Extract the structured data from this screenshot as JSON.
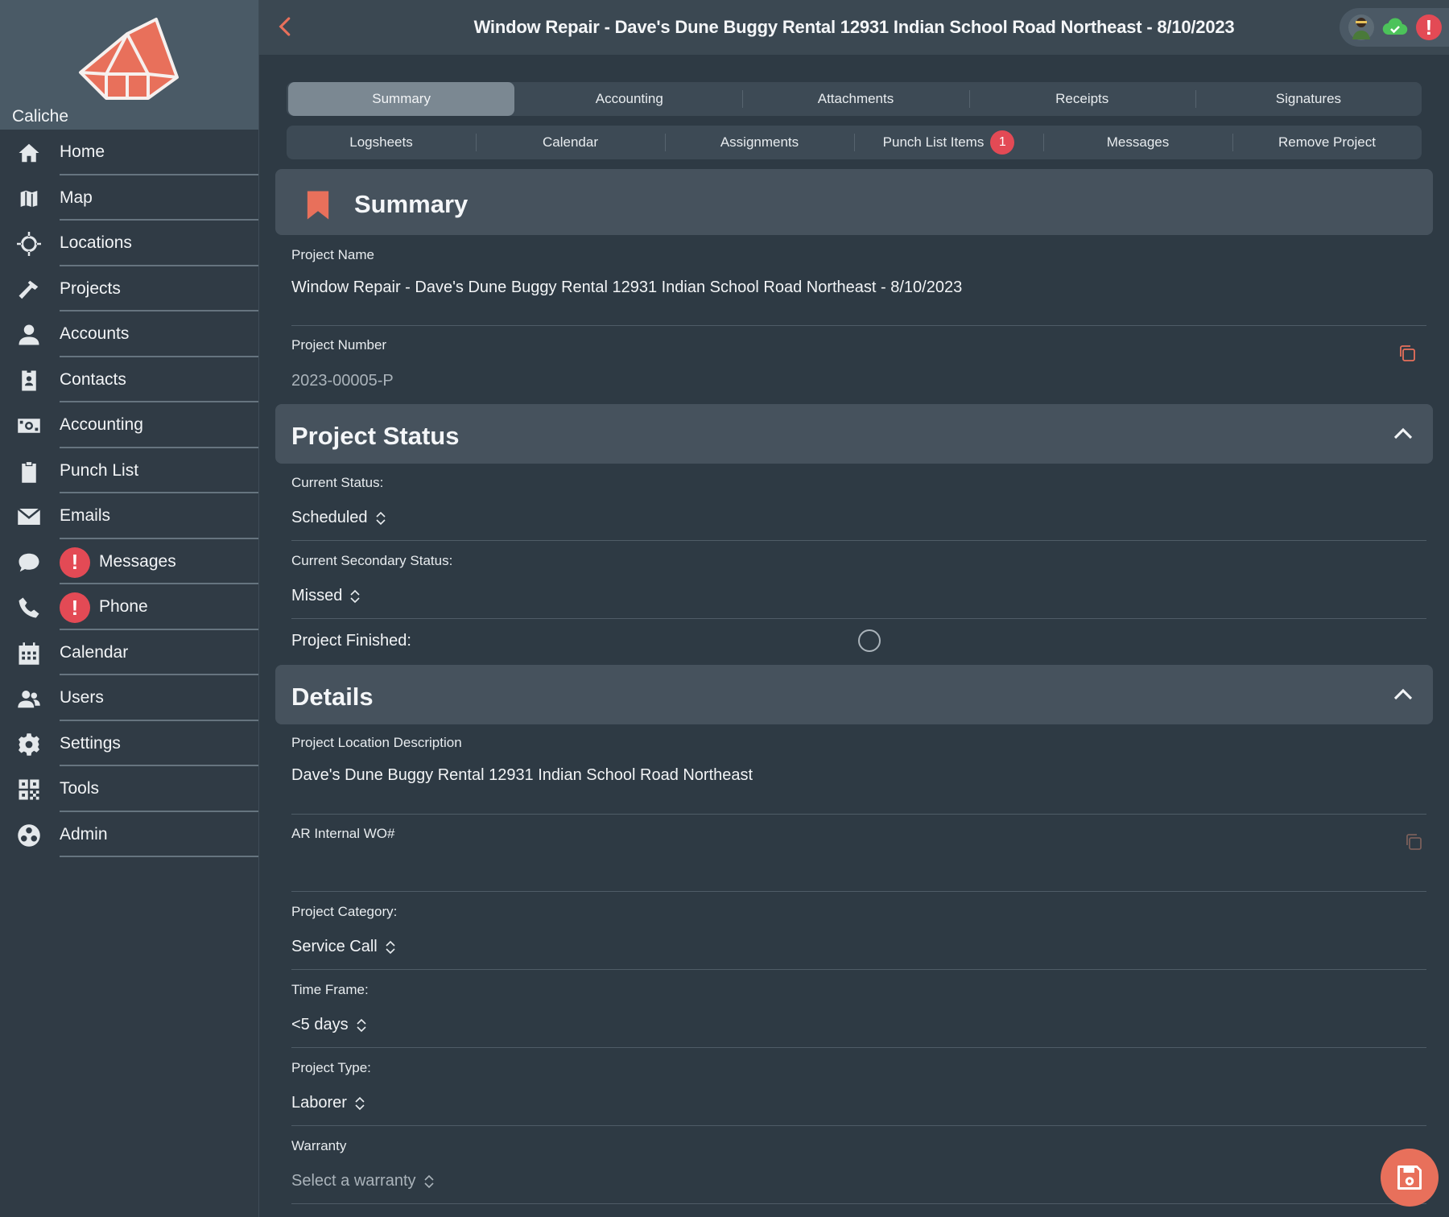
{
  "brand": {
    "name": "Caliche",
    "color": "#e8705b"
  },
  "nav": [
    {
      "label": "Home",
      "icon": "home-icon"
    },
    {
      "label": "Map",
      "icon": "map-icon"
    },
    {
      "label": "Locations",
      "icon": "crosshair-icon"
    },
    {
      "label": "Projects",
      "icon": "hammer-icon"
    },
    {
      "label": "Accounts",
      "icon": "person-icon"
    },
    {
      "label": "Contacts",
      "icon": "contact-card-icon"
    },
    {
      "label": "Accounting",
      "icon": "money-icon"
    },
    {
      "label": "Punch List",
      "icon": "clipboard-icon"
    },
    {
      "label": "Emails",
      "icon": "envelope-icon"
    },
    {
      "label": "Messages",
      "icon": "chat-icon",
      "alert": "!"
    },
    {
      "label": "Phone",
      "icon": "phone-icon",
      "alert": "!"
    },
    {
      "label": "Calendar",
      "icon": "calendar-icon"
    },
    {
      "label": "Users",
      "icon": "users-icon"
    },
    {
      "label": "Settings",
      "icon": "gear-icon"
    },
    {
      "label": "Tools",
      "icon": "qr-grid-icon"
    },
    {
      "label": "Admin",
      "icon": "admin-icon"
    }
  ],
  "header": {
    "title": "Window Repair - Dave's Dune Buggy Rental 12931 Indian School Road Northeast - 8/10/2023",
    "alert": "!"
  },
  "tabs_row1": [
    {
      "label": "Summary",
      "active": true
    },
    {
      "label": "Accounting"
    },
    {
      "label": "Attachments"
    },
    {
      "label": "Receipts"
    },
    {
      "label": "Signatures"
    }
  ],
  "tabs_row2": [
    {
      "label": "Logsheets"
    },
    {
      "label": "Calendar"
    },
    {
      "label": "Assignments"
    },
    {
      "label": "Punch List Items",
      "badge": "1"
    },
    {
      "label": "Messages"
    },
    {
      "label": "Remove Project"
    }
  ],
  "summary": {
    "title": "Summary",
    "project_name_label": "Project Name",
    "project_name": "Window Repair - Dave's Dune Buggy Rental 12931 Indian School Road Northeast - 8/10/2023",
    "project_number_label": "Project Number",
    "project_number": "2023-00005-P"
  },
  "status": {
    "title": "Project Status",
    "current_label": "Current Status:",
    "current_value": "Scheduled",
    "secondary_label": "Current Secondary Status:",
    "secondary_value": "Missed",
    "finished_label": "Project Finished:"
  },
  "details": {
    "title": "Details",
    "location_label": "Project Location Description",
    "location_value": "Dave's Dune Buggy Rental 12931 Indian School Road Northeast",
    "wo_label": "AR Internal WO#",
    "wo_value": "",
    "category_label": "Project Category:",
    "category_value": "Service Call",
    "timeframe_label": "Time Frame:",
    "timeframe_value": "<5 days",
    "type_label": "Project Type:",
    "type_value": "Laborer",
    "warranty_label": "Warranty",
    "warranty_placeholder": "Select a warranty"
  },
  "colors": {
    "accent": "#e8705b",
    "alert": "#e34a55",
    "cloud": "#4cc35a"
  }
}
